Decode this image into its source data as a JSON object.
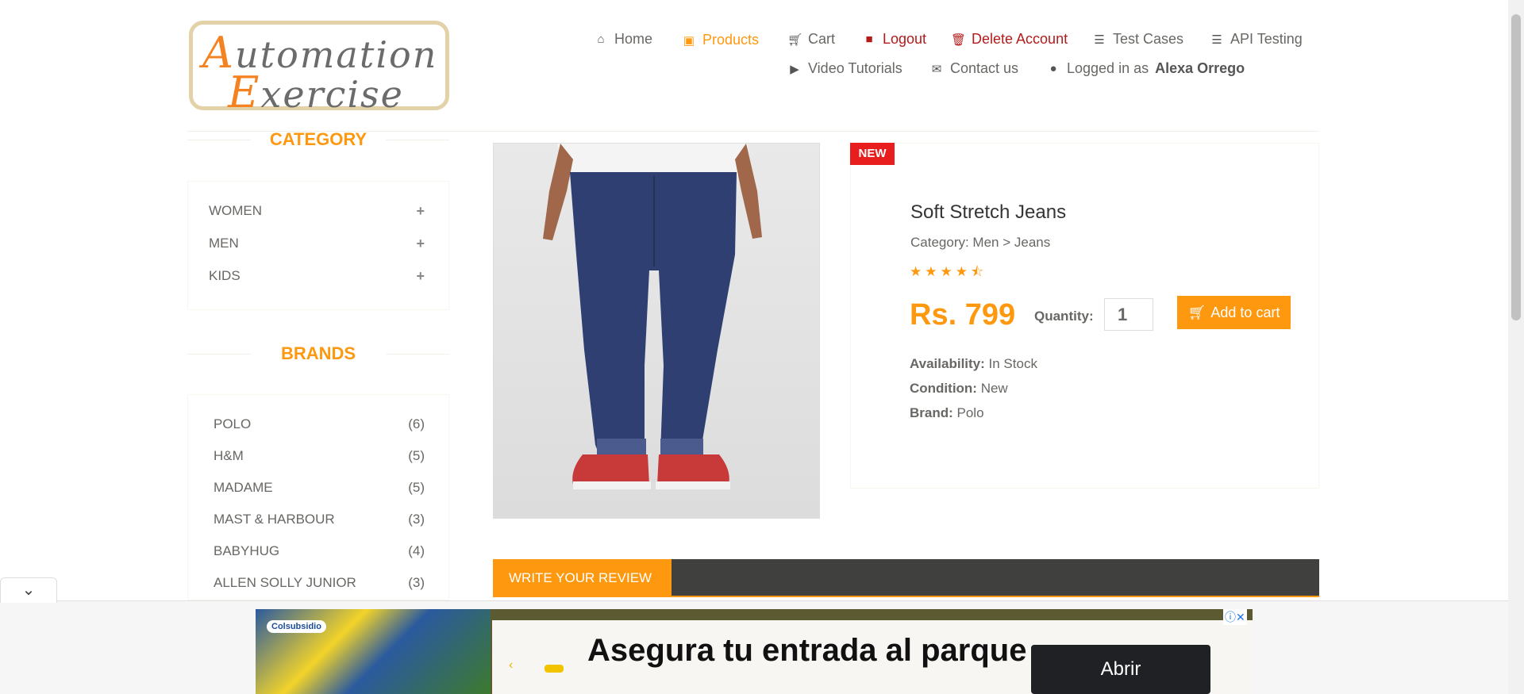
{
  "logo": {
    "line1": "Automation",
    "line2": "Exercise"
  },
  "nav": {
    "home": "Home",
    "products": "Products",
    "cart": "Cart",
    "logout": "Logout",
    "delete_account": "Delete Account",
    "test_cases": "Test Cases",
    "api_testing": "API Testing",
    "video_tutorials": "Video Tutorials",
    "contact_us": "Contact us",
    "logged_in_prefix": "Logged in as",
    "username": "Alexa Orrego"
  },
  "sidebar": {
    "category_title": "CATEGORY",
    "categories": [
      "WOMEN",
      "MEN",
      "KIDS"
    ],
    "brands_title": "BRANDS",
    "brands": [
      {
        "name": "POLO",
        "count": "(6)"
      },
      {
        "name": "H&M",
        "count": "(5)"
      },
      {
        "name": "MADAME",
        "count": "(5)"
      },
      {
        "name": "MAST & HARBOUR",
        "count": "(3)"
      },
      {
        "name": "BABYHUG",
        "count": "(4)"
      },
      {
        "name": "ALLEN SOLLY JUNIOR",
        "count": "(3)"
      }
    ]
  },
  "product": {
    "badge": "NEW",
    "name": "Soft Stretch Jeans",
    "category": "Category: Men > Jeans",
    "rating": 4.5,
    "price": "Rs. 799",
    "quantity_label": "Quantity:",
    "quantity": "1",
    "add_to_cart": "Add to cart",
    "availability_label": "Availability:",
    "availability": "In Stock",
    "condition_label": "Condition:",
    "condition": "New",
    "brand_label": "Brand:",
    "brand": "Polo"
  },
  "review": {
    "tab": "WRITE YOUR REVIEW"
  },
  "ad": {
    "brand": "Colsubsidio",
    "headline": "Asegura tu entrada al parque",
    "cta": "Abrir"
  },
  "colors": {
    "accent": "#fe980f",
    "danger": "#b31b1b",
    "badge": "#e81e1e"
  }
}
